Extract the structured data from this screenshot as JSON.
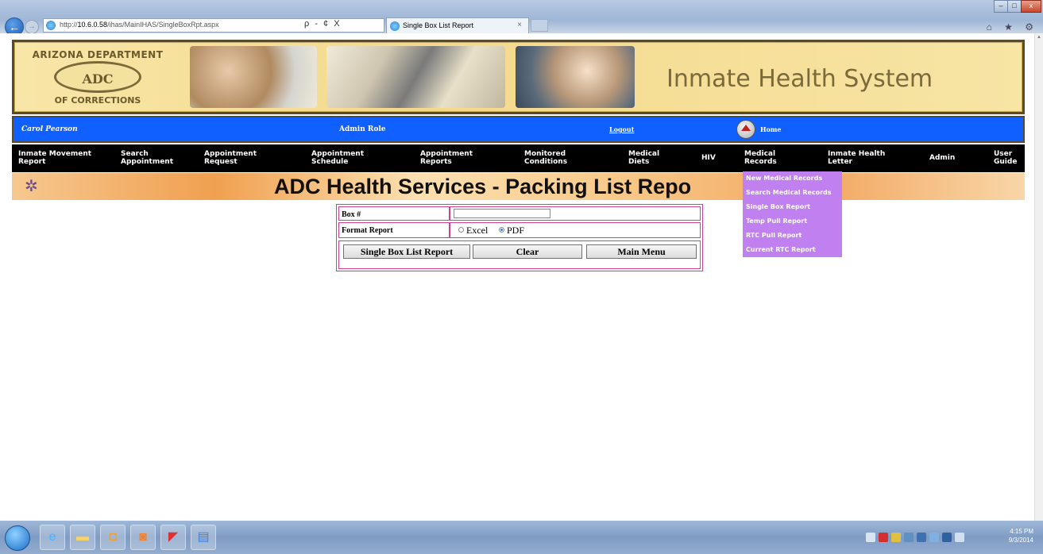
{
  "browser": {
    "url_prefix": "http://",
    "url_host": "10.6.0.58",
    "url_path": "/ihas/MainIHAS/SingleBoxRpt.aspx",
    "address_buttons": "ρ - ¢ X",
    "tab_title": "Single Box List Report",
    "tab_close": "×",
    "back_icon": "←",
    "forward_icon": "→",
    "minimize": "–",
    "maximize": "□",
    "close": "x",
    "tools": "⌂ ★ ⚙"
  },
  "banner": {
    "logo_top": "ARIZONA DEPARTMENT",
    "logo_center": "ADC",
    "logo_bottom": "OF CORRECTIONS",
    "system_title": "Inmate Health System"
  },
  "userbar": {
    "user": "Carol Pearson",
    "role": "Admin Role",
    "logout": "Logout",
    "home": "Home"
  },
  "menu": {
    "items": [
      {
        "line1": "Inmate Movement",
        "line2": "Report"
      },
      {
        "line1": "Search",
        "line2": "Appointment"
      },
      {
        "line1": "Appointment",
        "line2": "Request"
      },
      {
        "line1": "Appointment",
        "line2": "Schedule"
      },
      {
        "line1": "Appointment",
        "line2": "Reports"
      },
      {
        "line1": "Monitored",
        "line2": "Conditions"
      },
      {
        "line1": "Medical",
        "line2": "Diets"
      },
      {
        "line1": "HIV",
        "line2": ""
      },
      {
        "line1": "Medical",
        "line2": "Records"
      },
      {
        "line1": "Inmate Health",
        "line2": "Letter"
      },
      {
        "line1": "Admin",
        "line2": ""
      },
      {
        "line1": "User",
        "line2": "Guide"
      }
    ]
  },
  "dropdown": {
    "items": [
      "New Medical Records",
      "Search Medical Records",
      "Single Box Report",
      "Temp Pull Report",
      "RTC Pull Report",
      "Current RTC Report"
    ]
  },
  "page": {
    "title": "ADC Health Services - Packing List Repo",
    "gear_icon": "✲"
  },
  "form": {
    "box_label": "Box #",
    "box_value": "",
    "format_label": "Format Report",
    "format_options": [
      "Excel",
      "PDF"
    ],
    "format_selected": "PDF",
    "buttons": {
      "report": "Single Box List Report",
      "clear": "Clear",
      "main_menu": "Main Menu"
    }
  },
  "taskbar": {
    "clock_time": "4:15 PM",
    "clock_date": "9/3/2014"
  }
}
